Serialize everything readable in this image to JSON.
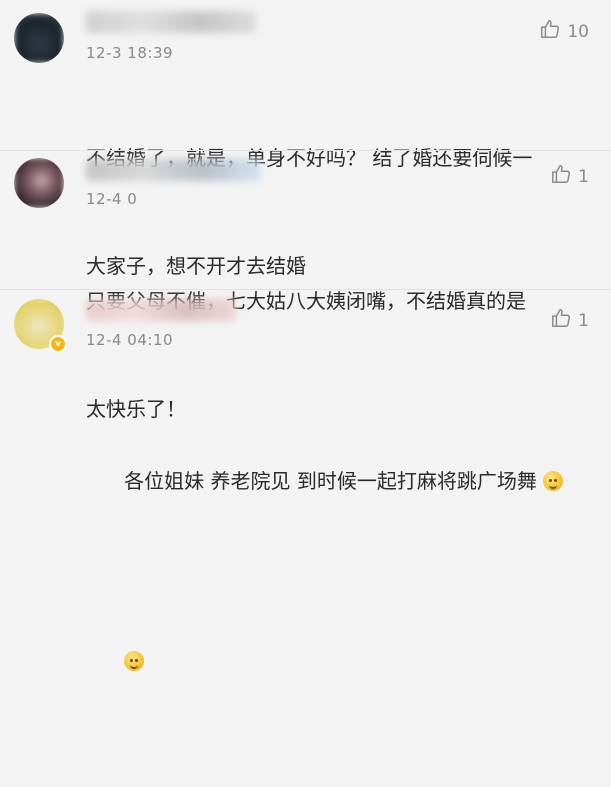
{
  "comments": [
    {
      "timestamp": "12-3 18:39",
      "likes": "10",
      "text": "不结婚了，就是，单身不好吗？ 结了婚还要伺候一大家子，想不开才去结婚",
      "line1": "不结婚了，就是，单身不好吗？ 结了婚还要伺候一",
      "line2": "大家子，想不开才去结婚"
    },
    {
      "timestamp": "12-4 0",
      "likes": "1",
      "line1": "只要父母不催，七大姑八大姨闭嘴，不结婚真的是",
      "line2": "太快乐了！"
    },
    {
      "timestamp": "12-4 04:10",
      "likes": "1",
      "line1": "各位姐妹 养老院见 到时候一起打麻将跳广场舞",
      "line2": "",
      "badge": "v"
    }
  ],
  "colors": {
    "background": "#f3f3f3",
    "text": "#2a2a2a",
    "meta": "#8a8a8a",
    "verified_badge": "#f3b818"
  },
  "icons": {
    "like": "thumbs-up-icon",
    "emoji": "smiley-emoji-icon"
  }
}
